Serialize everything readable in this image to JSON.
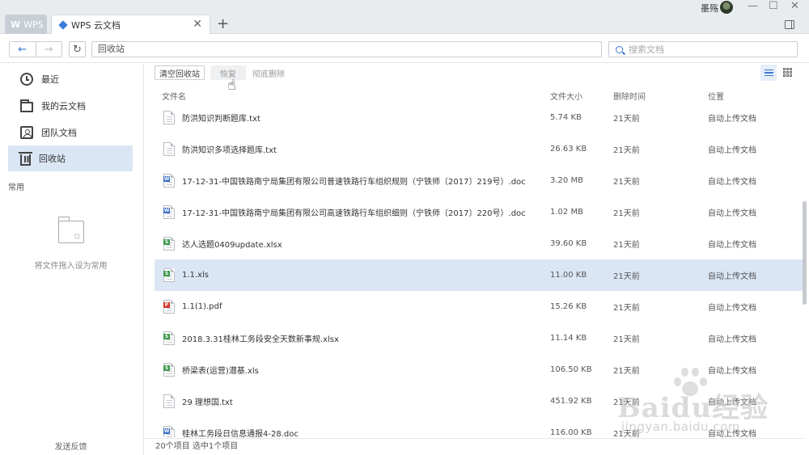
{
  "window": {
    "tabs": [
      {
        "label": "WPS",
        "logo": "W"
      },
      {
        "label": "WPS 云文档"
      }
    ],
    "user_name": "墨殇",
    "controls": {
      "minimize": "—",
      "maximize": "☐",
      "close": "✕"
    }
  },
  "toolbar": {
    "address": "回收站",
    "search_placeholder": "搜索文档"
  },
  "sidebar": {
    "items": [
      {
        "label": "最近",
        "icon": "clock-icon"
      },
      {
        "label": "我的云文档",
        "icon": "folder-icon"
      },
      {
        "label": "团队文档",
        "icon": "team-icon"
      },
      {
        "label": "回收站",
        "icon": "trash-icon",
        "active": true
      }
    ],
    "section_label": "常用",
    "favorites_hint": "将文件拖入设为常用",
    "feedback": "发送反馈"
  },
  "actions": {
    "clear": "清空回收站",
    "restore": "恢复",
    "delete": "彻底删除"
  },
  "table": {
    "headers": {
      "name": "文件名",
      "size": "文件大小",
      "time": "删除时间",
      "location": "位置"
    },
    "rows": [
      {
        "name": "防洪知识判断题库.txt",
        "type": "txt",
        "size": "5.74 KB",
        "time": "21天前",
        "location": "自动上传文档"
      },
      {
        "name": "防洪知识多项选择题库.txt",
        "type": "txt",
        "size": "26.63 KB",
        "time": "21天前",
        "location": "自动上传文档"
      },
      {
        "name": "17-12-31-中国铁路南宁局集团有限公司普速铁路行车组织规则（宁铁师〔2017〕219号）.doc",
        "type": "doc",
        "size": "3.20 MB",
        "time": "21天前",
        "location": "自动上传文档"
      },
      {
        "name": "17-12-31-中国铁路南宁局集团有限公司高速铁路行车组织细则（宁铁师〔2017〕220号）.doc",
        "type": "doc",
        "size": "1.02 MB",
        "time": "21天前",
        "location": "自动上传文档"
      },
      {
        "name": "达人选题0409update.xlsx",
        "type": "xls",
        "size": "39.60 KB",
        "time": "21天前",
        "location": "自动上传文档"
      },
      {
        "name": "1.1.xls",
        "type": "xls",
        "size": "11.00 KB",
        "time": "21天前",
        "location": "自动上传文档",
        "selected": true
      },
      {
        "name": "1.1(1).pdf",
        "type": "pdf",
        "size": "15.26 KB",
        "time": "21天前",
        "location": "自动上传文档"
      },
      {
        "name": "2018.3.31桂林工务段安全天数新事规.xlsx",
        "type": "xls",
        "size": "11.14 KB",
        "time": "21天前",
        "location": "自动上传文档"
      },
      {
        "name": "桥梁表(运营)潜基.xls",
        "type": "xls",
        "size": "106.50 KB",
        "time": "21天前",
        "location": "自动上传文档"
      },
      {
        "name": "29 理想国.txt",
        "type": "txt",
        "size": "451.92 KB",
        "time": "21天前",
        "location": "自动上传文档"
      },
      {
        "name": "桂林工务段日信息通报4-28.doc",
        "type": "doc",
        "size": "116.00 KB",
        "time": "21天前",
        "location": "自动上传文档"
      }
    ]
  },
  "status": "20个项目 选中1个项目",
  "watermark": {
    "logo": "Baidu经验",
    "sub": "jingyan.baidu.com"
  },
  "colors": {
    "accent": "#3c76d2",
    "selected_row": "#dbe6f5",
    "xls": "#3e9a4b",
    "doc": "#3d6ec7",
    "pdf": "#d23a2f"
  }
}
